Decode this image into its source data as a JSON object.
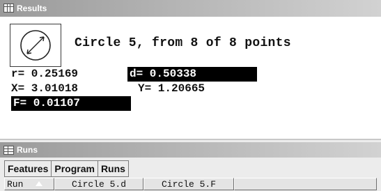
{
  "results": {
    "title": "Results",
    "heading": "Circle 5, from 8 of 8 points",
    "r": "r= 0.25169",
    "d": "d= 0.50338",
    "x": "X= 3.01018",
    "y": "Y= 1.20665",
    "f": "F= 0.01107",
    "icons": {
      "window": "grid-icon",
      "feature": "circle-feature-icon"
    }
  },
  "runs": {
    "title": "Runs",
    "tabs": [
      "Features",
      "Program",
      "Runs"
    ],
    "columns": [
      "Run",
      "Circle 5.d",
      "Circle 5.F",
      ""
    ],
    "icons": {
      "window": "runs-table-icon",
      "sort": "sort-ascending-icon"
    }
  },
  "colors": {
    "titlebar_start": "#9a9a9a",
    "titlebar_end": "#d2d2d2",
    "highlight_bg": "#000000",
    "highlight_fg": "#ffffff"
  }
}
